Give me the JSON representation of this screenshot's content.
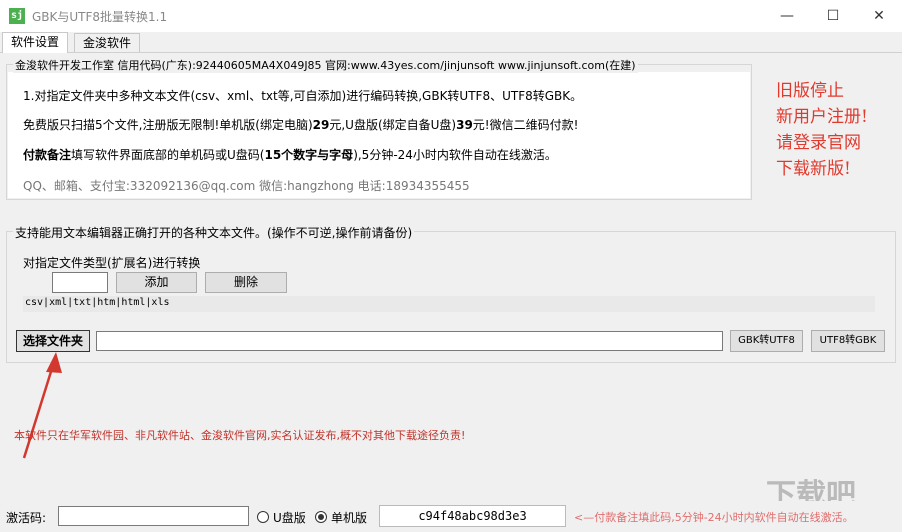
{
  "window": {
    "title": "GBK与UTF8批量转换1.1",
    "icon": "sj",
    "minimize": "—",
    "maximize": "☐",
    "close": "✕"
  },
  "tabs": [
    {
      "label": "软件设置"
    },
    {
      "label": "金浚软件"
    }
  ],
  "info": {
    "group_title": "金浚软件开发工作室 信用代码(广东):92440605MA4X049J85 官网:www.43yes.com/jinjunsoft  www.jinjunsoft.com(在建)",
    "line1": "1.对指定文件夹中多种文本文件(csv、xml、txt等,可自添加)进行编码转换,GBK转UTF8、UTF8转GBK。",
    "line2_a": "免费版只扫描5个文件,注册版无限制!单机版(绑定电脑)",
    "line2_b": "29",
    "line2_c": "元,U盘版(绑定自备U盘)",
    "line2_d": "39",
    "line2_e": "元!微信二维码付款!",
    "line3_a": "付款备注",
    "line3_b": "填写软件界面底部的单机码或U盘码(",
    "line3_c": "15个数字与字母",
    "line3_d": "),5分钟-24小时内软件自动在线激活。",
    "contact": "QQ、邮箱、支付宝:332092136@qq.com    微信:hangzhong    电话:18934355455"
  },
  "notice": [
    "旧版停止",
    "新用户注册!",
    "请登录官网",
    "下载新版!"
  ],
  "convert": {
    "group_title": "支持能用文本编辑器正确打开的各种文本文件。(操作不可逆,操作前请备份)",
    "ext_label": "对指定文件类型(扩展名)进行转换",
    "ext_value": "",
    "add_label": "添加",
    "delete_label": "删除",
    "ext_list": "csv|xml|txt|htm|html|xls",
    "select_folder_label": "选择文件夹",
    "folder_path": "",
    "gbk_to_utf8_label": "GBK转UTF8",
    "utf8_to_gbk_label": "UTF8转GBK"
  },
  "warning": "本软件只在华军软件园、非凡软件站、金浚软件官网,实名认证发布,概不对其他下载途径负责!",
  "status": {
    "activation_label": "激活码:",
    "activation_value": "",
    "usb_label": "U盘版",
    "standalone_label": "单机版",
    "machine_code": "c94f48abc98d3e3",
    "hint": "<—付款备注填此码,5分钟-24小时内软件自动在线激活。"
  },
  "watermark": "下载吧",
  "colors": {
    "notice": "#e03a2e",
    "warning": "#c0322a",
    "arrow": "#d2382e",
    "hint": "#e06e6e"
  }
}
